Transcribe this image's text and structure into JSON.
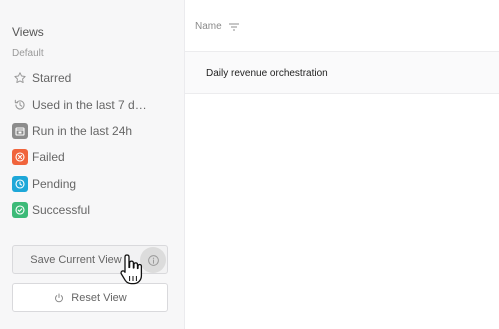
{
  "sidebar": {
    "title": "Views",
    "section_label": "Default",
    "items": [
      {
        "label": "Starred",
        "icon": "star-outline-icon"
      },
      {
        "label": "Used in the last 7 d…",
        "icon": "history-icon"
      },
      {
        "label": "Run in the last 24h",
        "icon": "calendar-icon",
        "color": "#8c8c8c"
      },
      {
        "label": "Failed",
        "icon": "x-circle-icon",
        "color": "#f0643c"
      },
      {
        "label": "Pending",
        "icon": "clock-icon",
        "color": "#1ea7d8"
      },
      {
        "label": "Successful",
        "icon": "check-circle-icon",
        "color": "#3cba78"
      }
    ],
    "save_button_label": "Save Current View",
    "reset_button_label": "Reset View"
  },
  "table": {
    "columns": [
      {
        "label": "Name",
        "sortable": true
      }
    ],
    "rows": [
      {
        "name": "Daily revenue orchestration"
      }
    ]
  }
}
